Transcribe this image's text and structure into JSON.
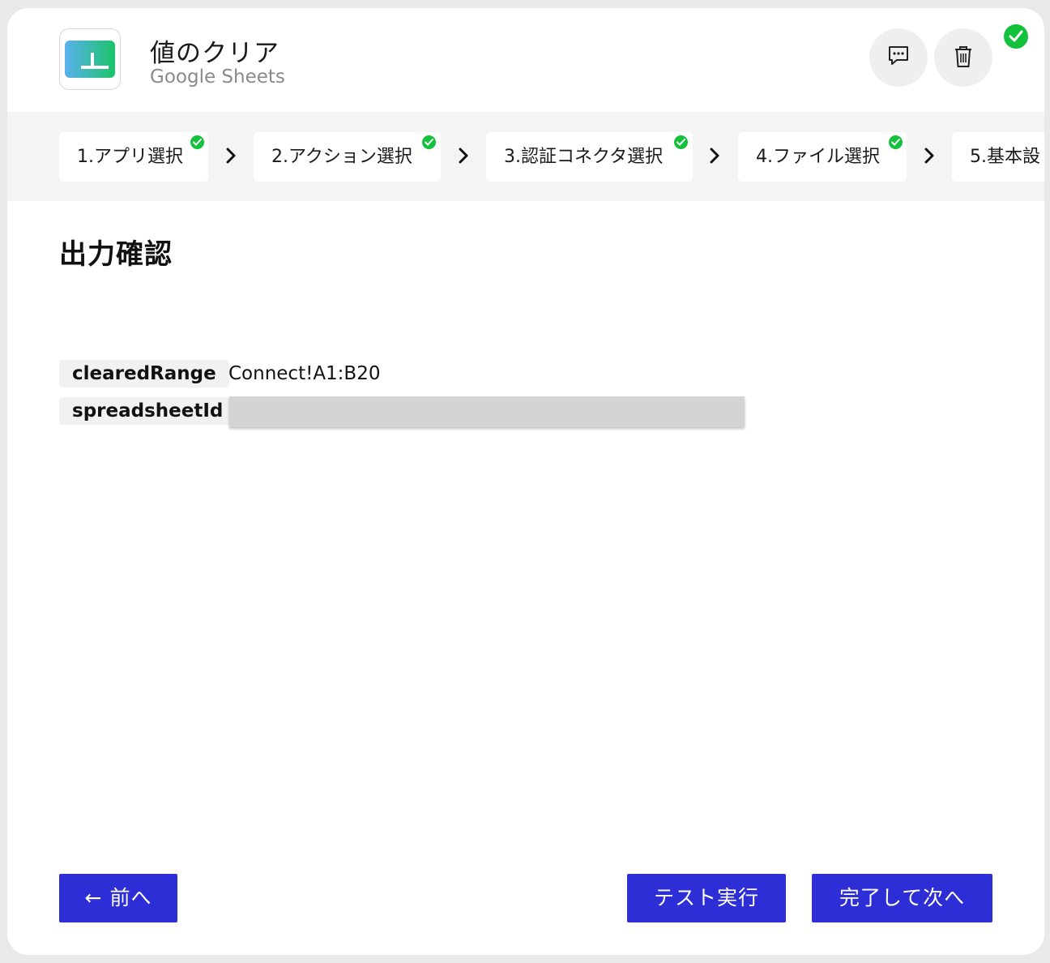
{
  "header": {
    "title": "値のクリア",
    "subtitle": "Google Sheets",
    "logo_icon": "google-sheets-logo",
    "comment_icon": "comment-icon",
    "trash_icon": "trash-icon",
    "status": "complete"
  },
  "steps": [
    {
      "label": "1.アプリ選択",
      "done": true
    },
    {
      "label": "2.アクション選択",
      "done": true
    },
    {
      "label": "3.認証コネクタ選択",
      "done": true
    },
    {
      "label": "4.ファイル選択",
      "done": true
    },
    {
      "label": "5.基本設",
      "done": false
    }
  ],
  "section": {
    "title": "出力確認"
  },
  "outputs": [
    {
      "key": "clearedRange",
      "value": "Connect!A1:B20"
    },
    {
      "key": "spreadsheetId",
      "value": ""
    }
  ],
  "buttons": {
    "prev": "← 前へ",
    "test": "テスト実行",
    "next": "完了して次へ"
  },
  "colors": {
    "accent": "#2e2ed6",
    "success": "#13c13b"
  }
}
